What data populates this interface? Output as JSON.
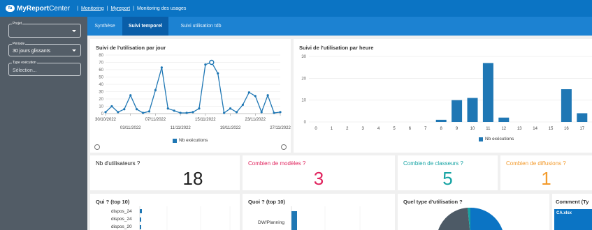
{
  "header": {
    "logo_badge": "fa",
    "logo_text_bold": "MyReport",
    "logo_text_rest": "Center",
    "breadcrumb": [
      "Monitoring",
      "Myreport",
      "Monitoring des usages"
    ]
  },
  "sidebar": {
    "fields": [
      {
        "label": "Projet",
        "value": "",
        "placeholder": ""
      },
      {
        "label": "Période",
        "value": "30 jours glissants",
        "placeholder": ""
      },
      {
        "label": "Type exécution",
        "value": "",
        "placeholder": "Sélection..."
      }
    ]
  },
  "tabs": [
    {
      "label": "Synthèse",
      "active": false
    },
    {
      "label": "Suivi temporel",
      "active": true
    },
    {
      "label": "Suivi utilisation tdb",
      "active": false
    }
  ],
  "colors": {
    "bar": "#1f77b4",
    "accent": "#0b74c4",
    "kpi1": "#222222",
    "kpi2": "#e0245e",
    "kpi3": "#15a3a3",
    "kpi4": "#f39a2b"
  },
  "cards": {
    "daily_title": "Suivi de l'utilisation par jour",
    "hourly_title": "Suivi de l'utilisation par heure",
    "kpis": [
      {
        "title": "Nb d'utilisateurs ?",
        "value": "18",
        "color": "#222222"
      },
      {
        "title": "Combien de modèles ?",
        "value": "3",
        "color": "#e0245e"
      },
      {
        "title": "Combien de classeurs ?",
        "value": "5",
        "color": "#15a3a3"
      },
      {
        "title": "Combien de diffusions ?",
        "value": "1",
        "color": "#f39a2b"
      }
    ],
    "bottom": [
      {
        "title": "Qui ? (top 10)",
        "rows": [
          "dispos_24",
          "dispos_24",
          "dispos_20"
        ]
      },
      {
        "title": "Quoi ? (top 10)",
        "rows": [
          "DW/Planning"
        ]
      },
      {
        "title": "Quel type d'utilisation ?"
      },
      {
        "title": "Comment (Ty",
        "rows": [
          "CA.xlsx"
        ]
      }
    ]
  },
  "chart_data": [
    {
      "type": "line",
      "title": "Suivi de l'utilisation par jour",
      "series": [
        {
          "name": "Nb exécutions",
          "values": [
            2,
            10,
            2,
            6,
            25,
            6,
            1,
            3,
            32,
            63,
            7,
            4,
            1,
            1,
            2,
            7,
            67,
            70,
            55,
            1,
            7,
            2,
            12,
            29,
            24,
            2,
            25,
            1,
            2
          ]
        }
      ],
      "ylim": [
        0,
        80
      ],
      "yticks": [
        0,
        10,
        20,
        30,
        40,
        50,
        60,
        70,
        80
      ],
      "xticks_top": [
        "30/10/2022",
        "07/11/2022",
        "15/11/2022",
        "23/11/2022"
      ],
      "xticks_bottom": [
        "03/11/2022",
        "11/11/2022",
        "19/11/2022",
        "27/11/2022"
      ],
      "legend": "Nb exécutions"
    },
    {
      "type": "bar",
      "title": "Suivi de l'utilisation par heure",
      "categories": [
        "0",
        "1",
        "2",
        "3",
        "4",
        "5",
        "6",
        "7",
        "8",
        "9",
        "10",
        "11",
        "12",
        "13",
        "14",
        "15",
        "16",
        "17"
      ],
      "series": [
        {
          "name": "Nb exécutions",
          "values": [
            0,
            0,
            0,
            0,
            0,
            0,
            0,
            0,
            1,
            10,
            11,
            27,
            2,
            0,
            0,
            0,
            15,
            4
          ]
        }
      ],
      "ylim": [
        0,
        30
      ],
      "yticks": [
        0,
        10,
        20,
        30
      ],
      "legend": "Nb exécutions"
    },
    {
      "type": "pie",
      "title": "Quel type d'utilisation ?",
      "values": []
    }
  ]
}
